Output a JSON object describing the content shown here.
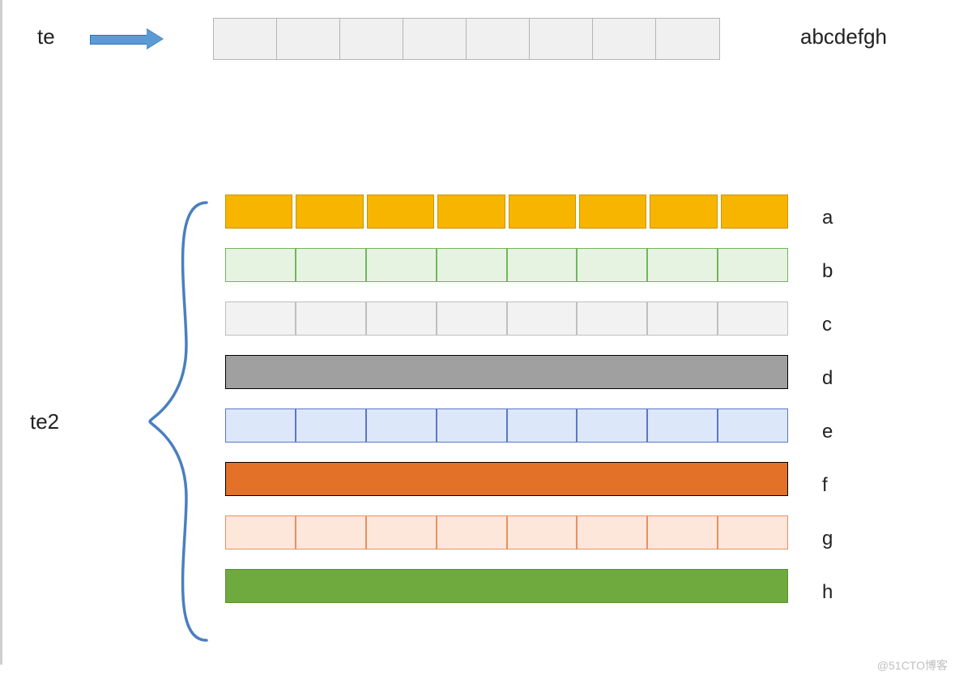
{
  "labels": {
    "te": "te",
    "te2": "te2",
    "top_sequence": "abcdefgh"
  },
  "top_row": {
    "cell_count": 8
  },
  "rows": [
    {
      "id": "a",
      "label": "a",
      "type": "segmented-gap",
      "cell_count": 8,
      "color": "#f7b500",
      "border": "#c99400"
    },
    {
      "id": "b",
      "label": "b",
      "type": "segmented",
      "cell_count": 8,
      "color": "#e7f3e1",
      "border": "#6fb65a"
    },
    {
      "id": "c",
      "label": "c",
      "type": "segmented",
      "cell_count": 8,
      "color": "#f2f2f2",
      "border": "#bfbfbf"
    },
    {
      "id": "d",
      "label": "d",
      "type": "solid",
      "color": "#a0a0a0",
      "border": "#000000"
    },
    {
      "id": "e",
      "label": "e",
      "type": "segmented",
      "cell_count": 8,
      "color": "#dde7fa",
      "border": "#5b77c9"
    },
    {
      "id": "f",
      "label": "f",
      "type": "solid",
      "color": "#e37228",
      "border": "#000000"
    },
    {
      "id": "g",
      "label": "g",
      "type": "segmented",
      "cell_count": 8,
      "color": "#fce7da",
      "border": "#e99060"
    },
    {
      "id": "h",
      "label": "h",
      "type": "solid",
      "color": "#6eaa3e",
      "border": "#5a8e30"
    }
  ],
  "watermark": "@51CTO博客"
}
